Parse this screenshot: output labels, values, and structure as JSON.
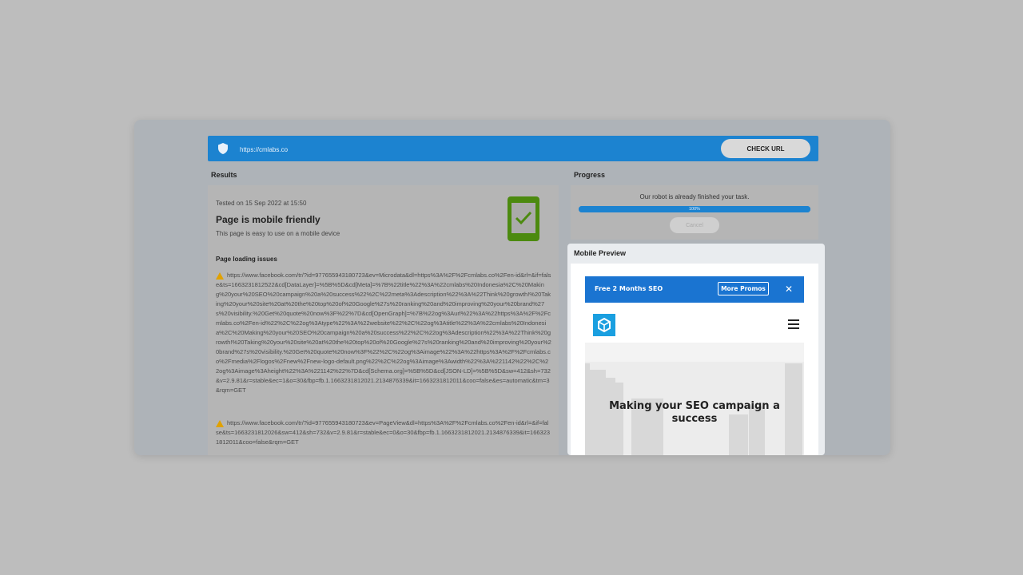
{
  "url_bar": {
    "placeholder": "https://cmlabs.co",
    "check_label": "CHECK URL"
  },
  "results": {
    "section_title": "Results",
    "tested_on": "Tested on 15 Sep 2022 at 15:50",
    "headline": "Page is mobile friendly",
    "subline": "This page is easy to use on a mobile device",
    "issues_title": "Page loading issues",
    "issues": [
      "https://www.facebook.com/tr/?id=977655943180723&ev=Microdata&dl=https%3A%2F%2Fcmlabs.co%2Fen-id&rl=&if=false&ts=1663231812522&cd[DataLayer]=%5B%5D&cd[Meta]=%7B%22title%22%3A%22cmlabs%20Indonesia%2C%20Making%20your%20SEO%20campaign%20a%20success%22%2C%22meta%3Adescription%22%3A%22Think%20growth!%20Taking%20your%20site%20at%20the%20top%20of%20Google%27s%20ranking%20and%20improving%20your%20brand%27s%20visibility.%20Get%20quote%20now%3F%22%7D&cd[OpenGraph]=%7B%22og%3Aurl%22%3A%22https%3A%2F%2Fcmlabs.co%2Fen-id%22%2C%22og%3Atype%22%3A%22website%22%2C%22og%3Atitle%22%3A%22cmlabs%20Indonesia%2C%20Making%20your%20SEO%20campaign%20a%20success%22%2C%22og%3Adescription%22%3A%22Think%20growth!%20Taking%20your%20site%20at%20the%20top%20of%20Google%27s%20ranking%20and%20improving%20your%20brand%27s%20visibility.%20Get%20quote%20now%3F%22%2C%22og%3Aimage%22%3A%22https%3A%2F%2Fcmlabs.co%2Fmedia%2Flogos%2Fnew%2Fnew-logo-default.png%22%2C%22og%3Aimage%3Awidth%22%3A%221142%22%2C%22og%3Aimage%3Aheight%22%3A%221142%22%7D&cd[Schema.org]=%5B%5D&cd[JSON-LD]=%5B%5D&sw=412&sh=732&v=2.9.81&r=stable&ec=1&o=30&fbp=fb.1.1663231812021.2134876339&it=1663231812011&coo=false&es=automatic&tm=3&rqm=GET",
      "https://www.facebook.com/tr/?id=977655943180723&ev=PageView&dl=https%3A%2F%2Fcmlabs.co%2Fen-id&rl=&if=false&ts=1663231812026&sw=412&sh=732&v=2.9.81&r=stable&ec=0&o=30&fbp=fb.1.1663231812021.2134876339&it=1663231812011&coo=false&rqm=GET"
    ]
  },
  "progress": {
    "section_title": "Progress",
    "message": "Our robot is already finished your task.",
    "percent_label": "100%",
    "percent": 100,
    "cancel_label": "Cancel"
  },
  "mobile_preview": {
    "title": "Mobile Preview",
    "promo_text": "Free 2 Months SEO",
    "promo_button": "More Promos",
    "close_glyph": "✕",
    "hero_text": "Making your SEO campaign a success"
  },
  "colors": {
    "accent": "#1c83d0",
    "success": "#4c8a0f",
    "warning": "#e0a100"
  }
}
